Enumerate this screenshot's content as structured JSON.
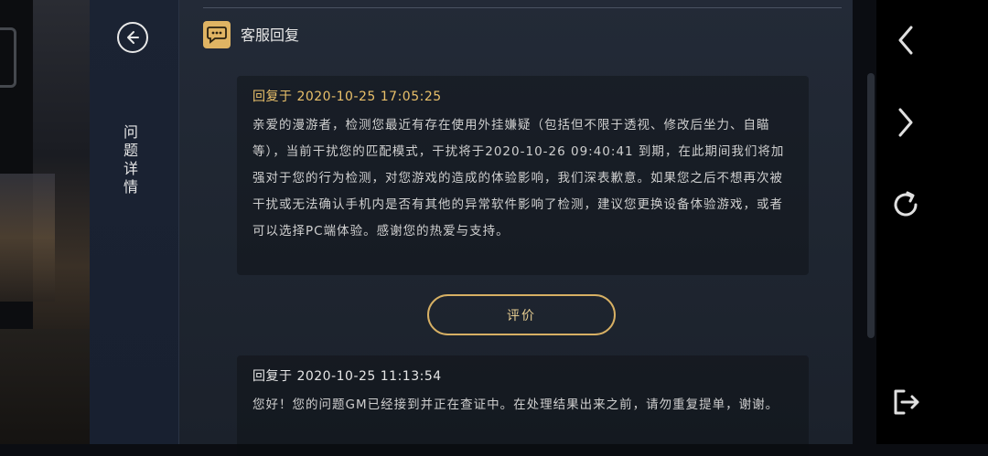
{
  "sidebar": {
    "title": "问题详情"
  },
  "header": {
    "title": "客服回复"
  },
  "replies": [
    {
      "time": "回复于 2020-10-25 17:05:25",
      "body": "亲爱的漫游者，检测您最近有存在使用外挂嫌疑（包括但不限于透视、修改后坐力、自瞄等），当前干扰您的匹配模式，干扰将于2020-10-26 09:40:41 到期，在此期间我们将加强对于您的行为检测，对您游戏的造成的体验影响，我们深表歉意。如果您之后不想再次被干扰或无法确认手机内是否有其他的异常软件影响了检测，建议您更换设备体验游戏，或者可以选择PC端体验。感谢您的热爱与支持。"
    },
    {
      "time": "回复于 2020-10-25 11:13:54",
      "body": "您好！您的问题GM已经接到并正在查证中。在处理结果出来之前，请勿重复提单，谢谢。"
    }
  ],
  "rate_button": "评价",
  "colors": {
    "accent_gold": "#e0b463",
    "time_gold": "#e9c06a",
    "panel": "#1b2333"
  },
  "icons": {
    "back": "back-arrow-icon",
    "chat": "chat-bubble-icon",
    "nav_back": "chevron-left-icon",
    "nav_forward": "chevron-right-icon",
    "reload": "reload-icon",
    "exit": "exit-icon"
  }
}
